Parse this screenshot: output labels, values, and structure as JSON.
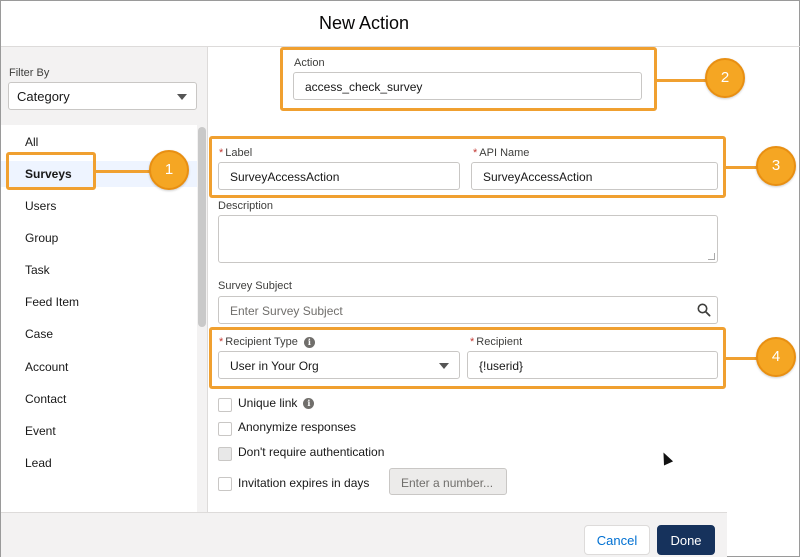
{
  "dialog": {
    "title": "New Action"
  },
  "sidebar": {
    "filter_label": "Filter By",
    "filter_value": "Category",
    "items": [
      {
        "label": "All"
      },
      {
        "label": "Surveys"
      },
      {
        "label": "Users"
      },
      {
        "label": "Group"
      },
      {
        "label": "Task"
      },
      {
        "label": "Feed Item"
      },
      {
        "label": "Case"
      },
      {
        "label": "Account"
      },
      {
        "label": "Contact"
      },
      {
        "label": "Event"
      },
      {
        "label": "Lead"
      }
    ],
    "active_item": "Surveys"
  },
  "form": {
    "action": {
      "label": "Action",
      "value": "access_check_survey"
    },
    "label_field": {
      "label": "Label",
      "value": "SurveyAccessAction",
      "required_mark": "*"
    },
    "api_name": {
      "label": "API Name",
      "value": "SurveyAccessAction",
      "required_mark": "*"
    },
    "description": {
      "label": "Description",
      "value": ""
    },
    "survey_subject": {
      "label": "Survey Subject",
      "placeholder": "Enter Survey Subject"
    },
    "recipient_type": {
      "label": "Recipient Type",
      "value": "User in Your Org",
      "required_mark": "*"
    },
    "recipient": {
      "label": "Recipient",
      "value": "{!userid}",
      "required_mark": "*"
    },
    "checkboxes": {
      "unique_link": "Unique link",
      "anonymize": "Anonymize responses",
      "no_auth": "Don't require authentication",
      "invitation": "Invitation expires in days"
    },
    "days_placeholder": "Enter a number..."
  },
  "callouts": [
    "1",
    "2",
    "3",
    "4"
  ],
  "footer": {
    "cancel_label": "Cancel",
    "done_label": "Done"
  },
  "colors": {
    "callout": "#f0a030",
    "primary": "#16325c",
    "link": "#0070d2",
    "required": "#c23934"
  },
  "icons": {
    "filter_caret": "chevron-down-icon",
    "search": "search-icon",
    "info": "info-icon"
  }
}
